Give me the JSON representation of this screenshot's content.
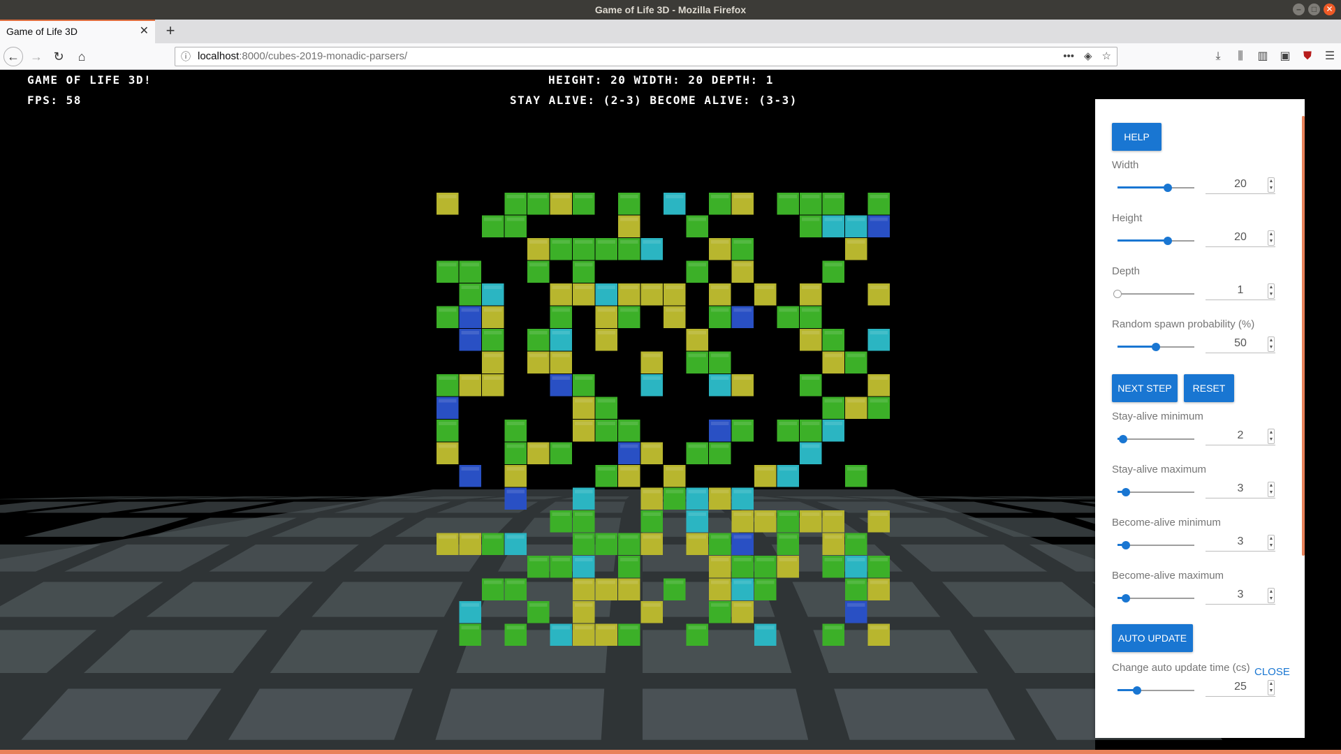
{
  "os_window": {
    "title": "Game of Life 3D - Mozilla Firefox"
  },
  "browser": {
    "tab_title": "Game of Life 3D",
    "url_host": "localhost",
    "url_rest": ":8000/cubes-2019-monadic-parsers/"
  },
  "hud": {
    "title": "Game of Life 3D!",
    "fps": "FPS: 58",
    "dimensions": "Height: 20 Width: 20 Depth: 1",
    "rules": "Stay alive: (2-3)  Become alive: (3-3)"
  },
  "panel": {
    "help_label": "HELP",
    "next_step_label": "NEXT STEP",
    "reset_label": "RESET",
    "auto_update_label": "AUTO UPDATE",
    "close_label": "CLOSE",
    "accent_color": "#1976d2",
    "controls": [
      {
        "label": "Width",
        "value": "20",
        "level": 0.65
      },
      {
        "label": "Height",
        "value": "20",
        "level": 0.65
      },
      {
        "label": "Depth",
        "value": "1",
        "level": 0.0
      },
      {
        "label": "Random spawn probability (%)",
        "value": "50",
        "level": 0.5
      },
      {
        "label": "Stay-alive minimum",
        "value": "2",
        "level": 0.07
      },
      {
        "label": "Stay-alive maximum",
        "value": "3",
        "level": 0.11
      },
      {
        "label": "Become-alive minimum",
        "value": "3",
        "level": 0.11
      },
      {
        "label": "Become-alive maximum",
        "value": "3",
        "level": 0.11
      },
      {
        "label": "Change auto update time (cs)",
        "value": "25",
        "level": 0.25
      }
    ]
  },
  "scene_colors": {
    "green": "#3cb028",
    "yellow": "#b8b62e",
    "cyan": "#2bb5c2",
    "blue": "#2950c4",
    "floor": "#4f575a"
  }
}
